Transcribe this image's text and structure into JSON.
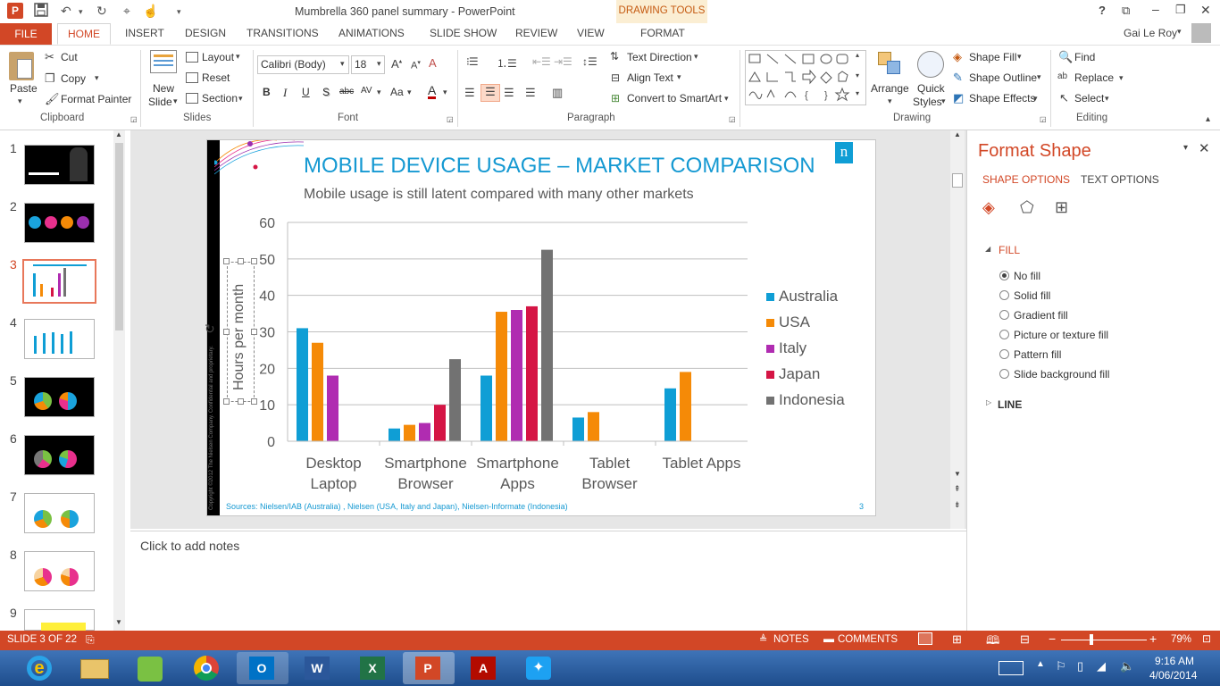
{
  "window": {
    "title": "Mumbrella 360 panel summary - PowerPoint",
    "help": "?",
    "user": "Gai Le Roy"
  },
  "tabs": {
    "file": "FILE",
    "home": "HOME",
    "insert": "INSERT",
    "design": "DESIGN",
    "transitions": "TRANSITIONS",
    "animations": "ANIMATIONS",
    "slideshow": "SLIDE SHOW",
    "review": "REVIEW",
    "view": "VIEW",
    "drawing_tools": "DRAWING TOOLS",
    "format": "FORMAT"
  },
  "ribbon": {
    "clipboard": {
      "label": "Clipboard",
      "paste": "Paste",
      "cut": "Cut",
      "copy": "Copy",
      "format_painter": "Format Painter"
    },
    "slides": {
      "label": "Slides",
      "new_slide_1": "New",
      "new_slide_2": "Slide",
      "layout": "Layout",
      "reset": "Reset",
      "section": "Section"
    },
    "font": {
      "label": "Font",
      "font_name": "Calibri (Body)",
      "font_size": "18",
      "bold": "B",
      "italic": "I",
      "underline": "U",
      "shadow": "S",
      "strike": "abc",
      "spacing": "AV",
      "case": "Aa",
      "color": "A"
    },
    "paragraph": {
      "label": "Paragraph",
      "text_direction": "Text Direction",
      "align_text": "Align Text",
      "convert_smartart": "Convert to SmartArt"
    },
    "drawing": {
      "label": "Drawing",
      "arrange": "Arrange",
      "quick_styles_1": "Quick",
      "quick_styles_2": "Styles",
      "shape_fill": "Shape Fill",
      "shape_outline": "Shape Outline",
      "shape_effects": "Shape Effects"
    },
    "editing": {
      "label": "Editing",
      "find": "Find",
      "replace": "Replace",
      "select": "Select"
    }
  },
  "thumbnails": [
    "1",
    "2",
    "3",
    "4",
    "5",
    "6",
    "7",
    "8",
    "9"
  ],
  "slide": {
    "title": "MOBILE DEVICE USAGE – MARKET COMPARISON",
    "subtitle": "Mobile usage is still latent compared with many other markets",
    "sources": "Sources: Nielsen/IAB (Australia) , Nielsen (USA, Italy and Japan), Nielsen-Informate (Indonesia)",
    "page_number": "3",
    "side_text": "Copyright ©2012 The Nielsen Company. Confidential and proprietary.",
    "logo": "n"
  },
  "chart_data": {
    "type": "bar",
    "ylabel": "Hours per month",
    "ylim": [
      0,
      60
    ],
    "yticks": [
      "0",
      "10",
      "20",
      "30",
      "40",
      "50",
      "60"
    ],
    "categories": [
      [
        "Desktop",
        "Laptop"
      ],
      [
        "Smartphone",
        "Browser"
      ],
      [
        "Smartphone",
        "Apps"
      ],
      [
        "Tablet",
        "Browser"
      ],
      [
        "Tablet Apps"
      ]
    ],
    "series": [
      {
        "name": "Australia",
        "color": "#0f9ed5",
        "values": [
          31,
          3.5,
          18,
          6.5,
          14.5
        ]
      },
      {
        "name": "USA",
        "color": "#f58a07",
        "values": [
          27,
          4.5,
          35.5,
          8,
          19
        ]
      },
      {
        "name": "Italy",
        "color": "#b02cb1",
        "values": [
          18,
          5,
          36,
          null,
          null
        ]
      },
      {
        "name": "Japan",
        "color": "#d51545",
        "values": [
          null,
          10,
          37,
          null,
          null
        ]
      },
      {
        "name": "Indonesia",
        "color": "#727272",
        "values": [
          null,
          22.5,
          52.5,
          null,
          null
        ]
      }
    ],
    "legend_position": "right",
    "grid": true
  },
  "notes": {
    "placeholder": "Click to add notes"
  },
  "format_pane": {
    "title": "Format Shape",
    "shape_options": "SHAPE OPTIONS",
    "text_options": "TEXT OPTIONS",
    "fill_header": "FILL",
    "line_header": "LINE",
    "fill_options": [
      "No fill",
      "Solid fill",
      "Gradient fill",
      "Picture or texture fill",
      "Pattern fill",
      "Slide background fill"
    ],
    "selected_fill": "No fill"
  },
  "status": {
    "slide_info": "SLIDE 3 OF 22",
    "notes": "NOTES",
    "comments": "COMMENTS",
    "zoom": "79%"
  },
  "taskbar": {
    "time": "9:16 AM",
    "date": "4/06/2014"
  }
}
